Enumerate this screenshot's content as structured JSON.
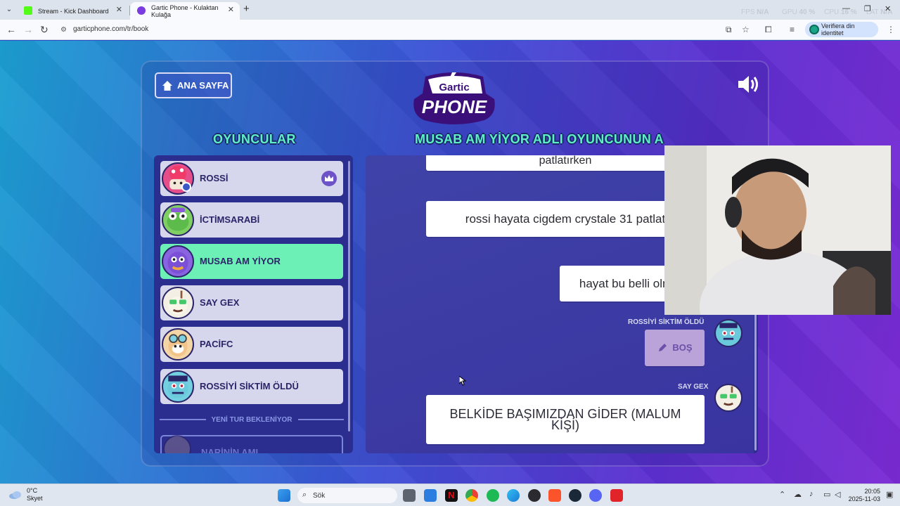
{
  "browser": {
    "tabs": [
      {
        "title": "Stream - Kick Dashboard",
        "active": false,
        "favicon_color": "#53fc18"
      },
      {
        "title": "Gartic Phone - Kulaktan Kulağa",
        "active": true,
        "favicon_color": "#7a3ce0"
      }
    ],
    "url": "garticphone.com/tr/book",
    "verify_label": "Verifiera din identitet",
    "overlay_stats": {
      "fps": "FPS",
      "fps_val": "N/A",
      "gpu": "GPU",
      "gpu_val": "40 %",
      "cpu": "CPU",
      "cpu_val": "16 %",
      "lat": "LAT",
      "lat_val": "N/A"
    }
  },
  "game": {
    "home_label": "ANA SAYFA",
    "logo_top": "Gartic",
    "logo_bottom": "PHONE",
    "players_title": "OYUNCULAR",
    "book_title": "MUSAB AM YİYOR ADLI OYUNCUNUN A",
    "players": [
      {
        "name": "ROSSİ",
        "owner": true,
        "active": false,
        "avatar_color": "#e64e8a"
      },
      {
        "name": "İCTİMSARABİ",
        "owner": false,
        "active": false,
        "avatar_color": "#6dc45a"
      },
      {
        "name": "MUSAB AM YİYOR",
        "owner": false,
        "active": true,
        "avatar_color": "#7a55d8"
      },
      {
        "name": "SAY GEX",
        "owner": false,
        "active": false,
        "avatar_color": "#f0ece0"
      },
      {
        "name": "PACİFC",
        "owner": false,
        "active": false,
        "avatar_color": "#f2c48a"
      },
      {
        "name": "ROSSİYİ SİKTİM ÖLDÜ",
        "owner": false,
        "active": false,
        "avatar_color": "#6fd2e0"
      }
    ],
    "waiting_label": "YENİ TUR BEKLENİYOR",
    "waiting_player": "NARİNİN AMI",
    "book": {
      "entries": [
        {
          "text": "patlatırken",
          "type": "text"
        },
        {
          "text": "rossi hayata cigdem crystale 31 patlat",
          "type": "text"
        },
        {
          "text": "hayat bu belli olmaz",
          "type": "text"
        },
        {
          "author": "ROSSİYİ SİKTİM ÖLDÜ",
          "text": "BOŞ",
          "type": "empty"
        },
        {
          "author": "SAY GEX",
          "text": "BELKİDE BAŞIMIZDAN GİDER (MALUM KİŞİ)",
          "type": "text"
        }
      ]
    }
  },
  "taskbar": {
    "weather_temp": "0°C",
    "weather_desc": "Skyet",
    "search_placeholder": "Sök",
    "time": "20:05",
    "date": "2025-11-03"
  }
}
